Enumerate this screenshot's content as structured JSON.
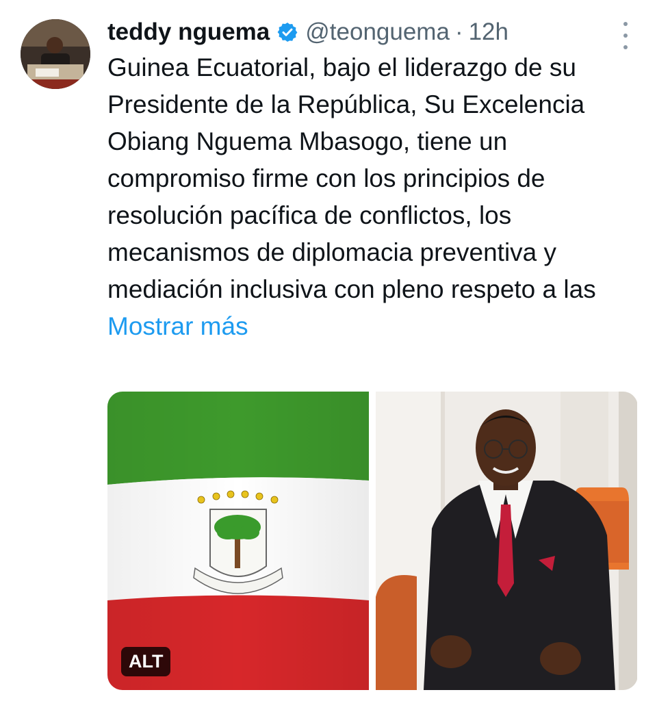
{
  "tweet": {
    "author_name": "teddy nguema",
    "handle": "@teonguema",
    "separator": "·",
    "time": "12h",
    "text": "Guinea Ecuatorial, bajo el liderazgo de su Presidente de la República, Su Excelencia Obiang Nguema Mbasogo, tiene un compromiso firme con los principios de resolución pacífica de conflictos, los mecanismos de diplomacia preventiva y mediación inclusiva con pleno respeto a las",
    "show_more": "Mostrar más"
  },
  "media": {
    "image1": {
      "alt_badge": "ALT",
      "depicts": "flag-of-equatorial-guinea"
    },
    "image2": {
      "depicts": "portrait-of-seated-man-in-suit"
    }
  },
  "colors": {
    "link": "#1d9bf0",
    "verified": "#1d9bf0",
    "secondary_text": "#536471",
    "flag_green": "#3e9a2c",
    "flag_white": "#ffffff",
    "flag_red": "#d7272a"
  }
}
